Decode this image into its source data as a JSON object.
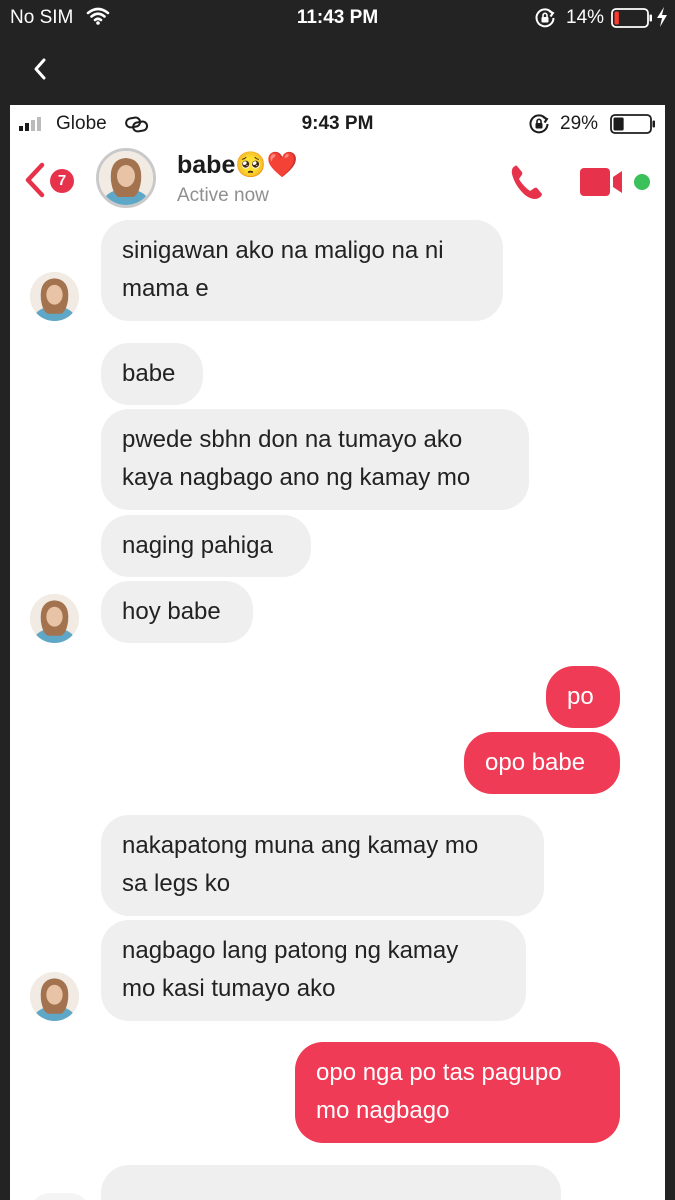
{
  "outer_status": {
    "carrier": "No SIM",
    "time": "11:43 PM",
    "battery_pct": "14%",
    "battery_level": 0.14
  },
  "inner_status": {
    "carrier": "Globe",
    "time": "9:43 PM",
    "battery_pct": "29%",
    "battery_level": 0.29
  },
  "header": {
    "unread_count": "7",
    "contact_name": "babe🥺❤️",
    "status": "Active now",
    "colors": {
      "accent": "#e7324b",
      "online": "#3cc05a"
    }
  },
  "messages": [
    {
      "side": "in",
      "text_lines": [
        "sinigawan ako na maligo na ni",
        "mama e"
      ]
    },
    {
      "side": "in",
      "text_lines": [
        "babe"
      ]
    },
    {
      "side": "in",
      "text_lines": [
        "pwede sbhn don na tumayo ako",
        "kaya nagbago ano ng kamay mo"
      ]
    },
    {
      "side": "in",
      "text_lines": [
        "naging pahiga"
      ]
    },
    {
      "side": "in",
      "text_lines": [
        "hoy babe"
      ]
    },
    {
      "side": "out",
      "text_lines": [
        "po"
      ]
    },
    {
      "side": "out",
      "text_lines": [
        "opo babe"
      ]
    },
    {
      "side": "in",
      "text_lines": [
        "nakapatong muna ang kamay mo",
        "sa legs ko"
      ]
    },
    {
      "side": "in",
      "text_lines": [
        "nagbago lang patong ng kamay",
        "mo kasi tumayo ako"
      ]
    },
    {
      "side": "out",
      "text_lines": [
        "opo nga po tas pagupo",
        "mo nagbago"
      ]
    }
  ]
}
